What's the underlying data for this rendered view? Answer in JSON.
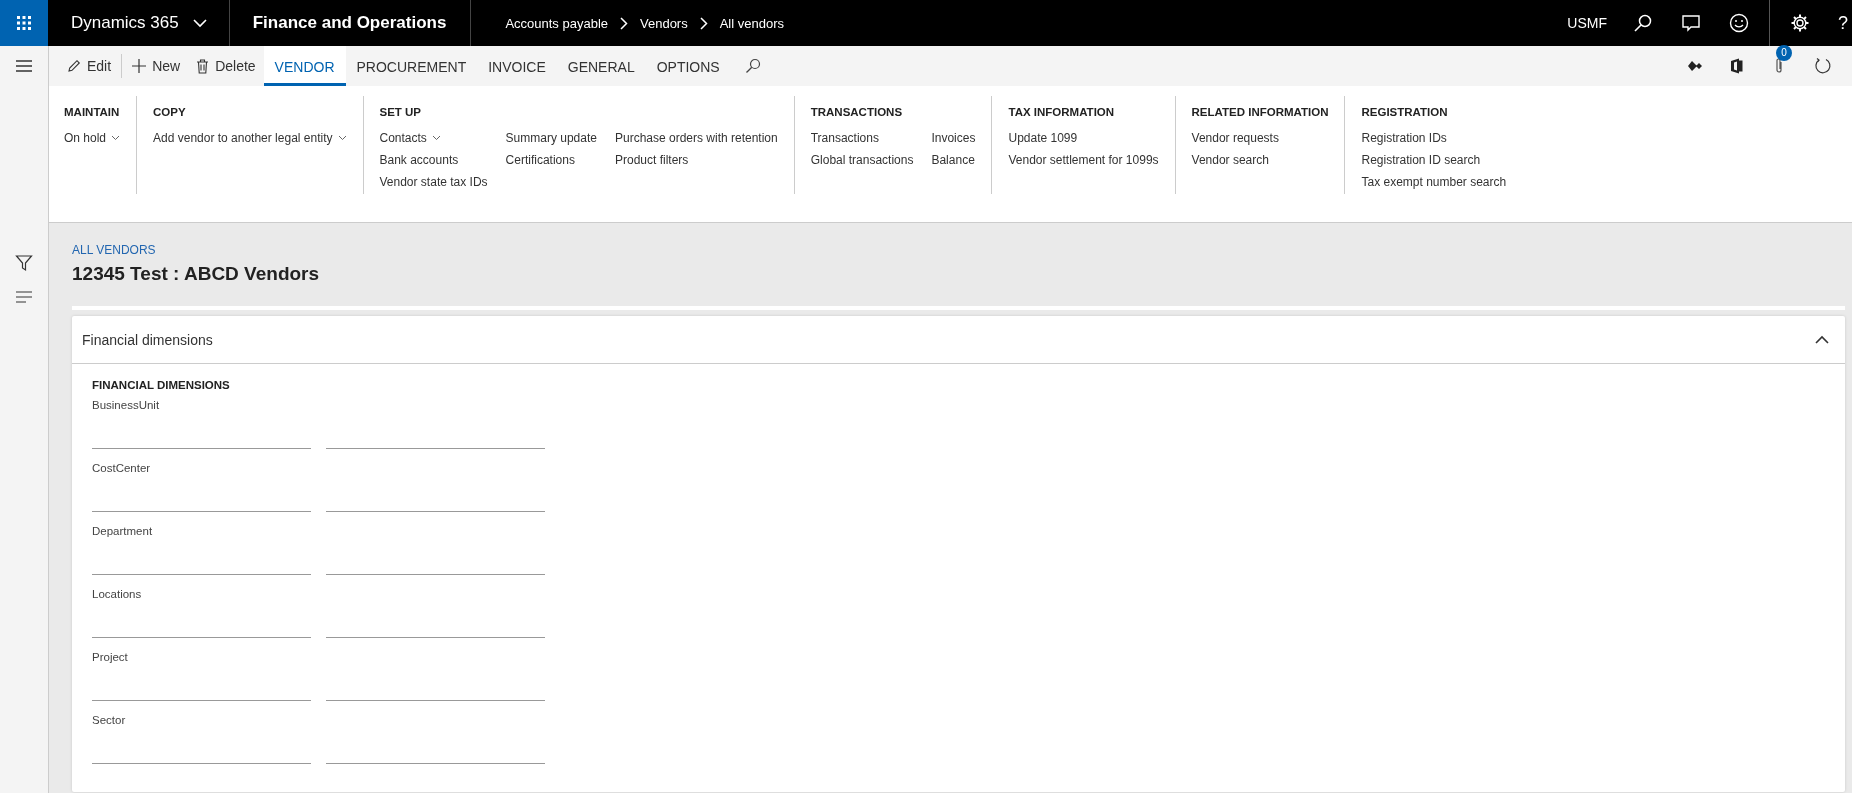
{
  "top_bar": {
    "product": "Dynamics 365",
    "module": "Finance and Operations",
    "breadcrumb": [
      "Accounts payable",
      "Vendors",
      "All vendors"
    ],
    "company": "USMF",
    "help": "?"
  },
  "action_bar": {
    "buttons": [
      {
        "kind": "edit",
        "label": "Edit"
      },
      {
        "kind": "new",
        "label": "New"
      },
      {
        "kind": "delete",
        "label": "Delete"
      }
    ],
    "tabs": [
      {
        "label": "VENDOR",
        "selected": true
      },
      {
        "label": "PROCUREMENT",
        "selected": false
      },
      {
        "label": "INVOICE",
        "selected": false
      },
      {
        "label": "GENERAL",
        "selected": false
      },
      {
        "label": "OPTIONS",
        "selected": false
      }
    ],
    "attachments_count": "0"
  },
  "ribbon": [
    {
      "title": "MAINTAIN",
      "columns": [
        [
          {
            "label": "On hold",
            "dropdown": true
          }
        ]
      ]
    },
    {
      "title": "COPY",
      "columns": [
        [
          {
            "label": "Add vendor to another legal entity",
            "dropdown": true
          }
        ]
      ]
    },
    {
      "title": "SET UP",
      "columns": [
        [
          {
            "label": "Contacts",
            "dropdown": true
          },
          {
            "label": "Bank accounts",
            "dropdown": false
          },
          {
            "label": "Vendor state tax IDs",
            "dropdown": false
          }
        ],
        [
          {
            "label": "Summary update",
            "dropdown": false
          },
          {
            "label": "Certifications",
            "dropdown": false
          }
        ],
        [
          {
            "label": "Purchase orders with retention",
            "dropdown": false
          },
          {
            "label": "Product filters",
            "dropdown": false
          }
        ]
      ]
    },
    {
      "title": "TRANSACTIONS",
      "columns": [
        [
          {
            "label": "Transactions",
            "dropdown": false
          },
          {
            "label": "Global transactions",
            "dropdown": false
          }
        ],
        [
          {
            "label": "Invoices",
            "dropdown": false
          },
          {
            "label": "Balance",
            "dropdown": false
          }
        ]
      ]
    },
    {
      "title": "TAX INFORMATION",
      "columns": [
        [
          {
            "label": "Update 1099",
            "dropdown": false
          },
          {
            "label": "Vendor settlement for 1099s",
            "dropdown": false
          }
        ]
      ]
    },
    {
      "title": "RELATED INFORMATION",
      "columns": [
        [
          {
            "label": "Vendor requests",
            "dropdown": false
          },
          {
            "label": "Vendor search",
            "dropdown": false
          }
        ]
      ]
    },
    {
      "title": "REGISTRATION",
      "columns": [
        [
          {
            "label": "Registration IDs",
            "dropdown": false
          },
          {
            "label": "Registration ID search",
            "dropdown": false
          },
          {
            "label": "Tax exempt number search",
            "dropdown": false
          }
        ]
      ]
    }
  ],
  "page": {
    "breadcrumb": "ALL VENDORS",
    "title": "12345 Test : ABCD Vendors"
  },
  "card": {
    "title": "Financial dimensions",
    "expanded": true,
    "section": "FINANCIAL DIMENSIONS",
    "fields": [
      {
        "label": "BusinessUnit"
      },
      {
        "label": "CostCenter"
      },
      {
        "label": "Department"
      },
      {
        "label": "Locations"
      },
      {
        "label": "Project"
      },
      {
        "label": "Sector"
      }
    ]
  }
}
